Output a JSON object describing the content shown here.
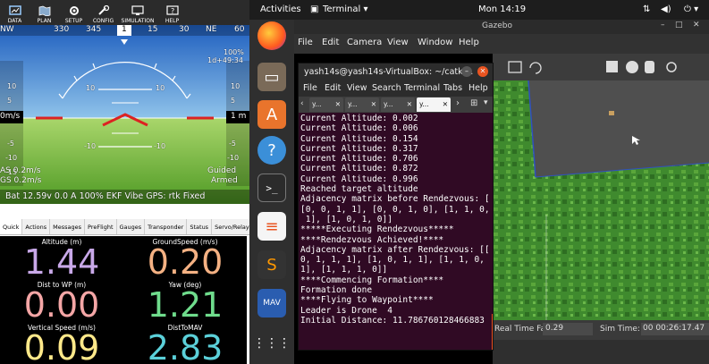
{
  "mission_planner": {
    "toolbar": [
      {
        "label": "DATA",
        "icon": "data-icon"
      },
      {
        "label": "PLAN",
        "icon": "plan-icon"
      },
      {
        "label": "SETUP",
        "icon": "setup-icon"
      },
      {
        "label": "CONFIG",
        "icon": "config-icon"
      },
      {
        "label": "SIMULATION",
        "icon": "simulation-icon"
      },
      {
        "label": "HELP",
        "icon": "help-icon"
      }
    ],
    "hud": {
      "compass": [
        "NW",
        "330",
        "345",
        "1",
        "15",
        "30",
        "NE",
        "60"
      ],
      "battery_pct": "100%",
      "hdop": "1d+49:34",
      "left_speed": "0m/s",
      "right_alt": "1 m",
      "left_scale": [
        "10",
        "5",
        "0",
        "-5",
        "-10",
        "-15"
      ],
      "right_scale": [
        "10",
        "5",
        "0",
        "-5",
        "-10"
      ],
      "pitch_top": [
        "10",
        "10"
      ],
      "pitch_mid": [
        "0",
        "0"
      ],
      "pitch_low": [
        "-10",
        "-10"
      ],
      "airspeed": "AS 0.2m/s",
      "groundspeed": "GS 0.2m/s",
      "mode": "Guided",
      "armed": "Armed",
      "status_bar": "Bat 12.59v 0.0 A 100%   EKF   Vibe   GPS: rtk Fixed"
    },
    "tabs": [
      "Quick",
      "Actions",
      "Messages",
      "PreFlight",
      "Gauges",
      "Transponder",
      "Status",
      "Servo/Relay"
    ],
    "quick": [
      {
        "label": "Altitude (m)",
        "value": "1.44",
        "color": "#c8a8e8"
      },
      {
        "label": "GroundSpeed (m/s)",
        "value": "0.20",
        "color": "#f4b183"
      },
      {
        "label": "Dist to WP (m)",
        "value": "0.00",
        "color": "#f4a6a6"
      },
      {
        "label": "Yaw (deg)",
        "value": "1.21",
        "color": "#6fdc8c"
      },
      {
        "label": "Vertical Speed (m/s)",
        "value": "0.09",
        "color": "#ffe98a"
      },
      {
        "label": "DistToMAV",
        "value": "2.83",
        "color": "#5bd0d9"
      }
    ]
  },
  "topbar": {
    "activities": "Activities",
    "app": "Terminal ▾",
    "clock": "Mon 14:19"
  },
  "dock": [
    "firefox-icon",
    "files-icon",
    "software-icon",
    "help-icon",
    "terminal-icon",
    "text-editor-icon",
    "sublime-icon",
    "mavconsole-icon",
    "apps-grid-icon"
  ],
  "gazebo": {
    "title": "Gazebo",
    "menu": [
      "File",
      "Edit",
      "Camera",
      "View",
      "Window",
      "Help"
    ],
    "sim_factor_label": "Real Time Factor:",
    "sim_factor": "0.29",
    "sim_time_label": "Sim Time:",
    "sim_time": "00 00:26:17.47"
  },
  "terminal": {
    "title": "yash14s@yash14s-VirtualBox: ~/catki...",
    "menu": [
      "File",
      "Edit",
      "View",
      "Search",
      "Terminal",
      "Tabs",
      "Help"
    ],
    "tabs": [
      "y...",
      "y...",
      "y...",
      "y..."
    ],
    "lines": [
      "Current Altitude: 0.002",
      "Current Altitude: 0.006",
      "Current Altitude: 0.154",
      "Current Altitude: 0.317",
      "Current Altitude: 0.706",
      "Current Altitude: 0.872",
      "Current Altitude: 0.996",
      "Reached target altitude",
      "Adjacency matrix before Rendezvous: [",
      "[0, 0, 1, 1], [0, 0, 1, 0], [1, 1, 0,",
      " 1], [1, 0, 1, 0]]",
      "*****Executing Rendezvous*****",
      "****Rendezvous Achieved!****",
      "Adjacency matrix after Rendezvous: [[",
      "0, 1, 1, 1], [1, 0, 1, 1], [1, 1, 0,",
      "1], [1, 1, 1, 0]]",
      "****Commencing Formation****",
      "Formation done",
      "****Flying to Waypoint****",
      "Leader is Drone  4",
      "Initial Distance: 11.786760128466883"
    ]
  }
}
